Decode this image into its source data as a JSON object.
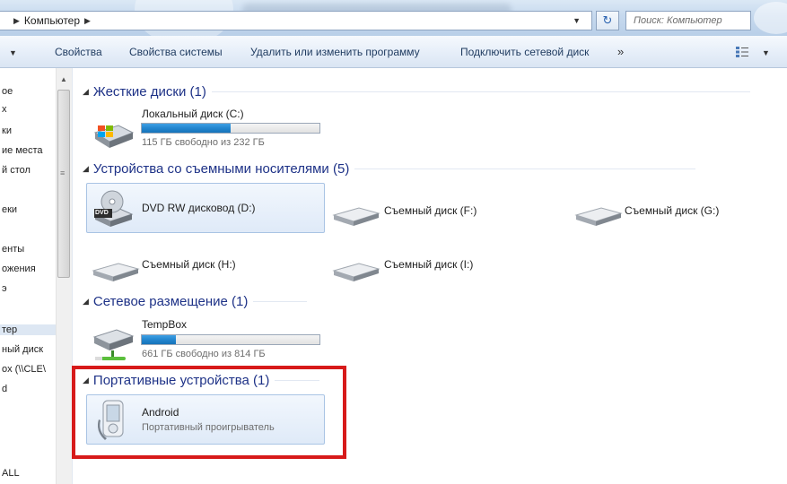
{
  "address": {
    "path": [
      "Компьютер"
    ],
    "search_placeholder": "Поиск: Компьютер",
    "refresh_symbol": "↻"
  },
  "toolbar": {
    "items": [
      "Свойства",
      "Свойства системы",
      "Удалить или изменить программу",
      "Подключить сетевой диск"
    ],
    "more": "»"
  },
  "nav": {
    "items": [
      "ое",
      "х",
      "ки",
      "ие места",
      "й стол",
      "еки",
      "енты",
      "ожения",
      "э",
      "тер",
      "ный диск",
      "ox (\\\\CLE\\",
      "d",
      "ALL"
    ],
    "selected_index": 9
  },
  "groups": {
    "hard_drives": {
      "title": "Жесткие диски (1)"
    },
    "removable": {
      "title": "Устройства со съемными носителями (5)"
    },
    "network": {
      "title": "Сетевое размещение (1)"
    },
    "portable": {
      "title": "Портативные устройства (1)"
    }
  },
  "drives": {
    "c": {
      "name": "Локальный диск (C:)",
      "free_text": "115 ГБ свободно из 232 ГБ",
      "used_fraction": 0.5
    },
    "dvd": {
      "name": "DVD RW дисковод (D:)",
      "icon_label": "DVD"
    },
    "f": {
      "name": "Съемный диск (F:)"
    },
    "g": {
      "name": "Съемный диск (G:)"
    },
    "h": {
      "name": "Съемный диск (H:)"
    },
    "i": {
      "name": "Съемный диск (I:)"
    },
    "tempbox": {
      "name": "TempBox",
      "free_text": "661 ГБ свободно из 814 ГБ",
      "used_fraction": 0.19
    },
    "android": {
      "name": "Android",
      "subtitle": "Портативный проигрыватель"
    }
  },
  "colors": {
    "group_title": "#1e3287",
    "bar_fill": "#2386cf",
    "highlight_border": "#d71a1a"
  }
}
